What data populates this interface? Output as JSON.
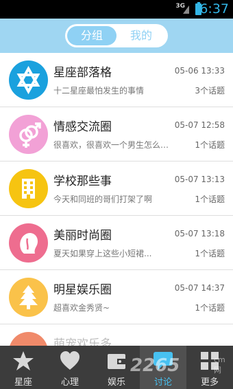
{
  "status_bar": {
    "network": "3G",
    "time": "6:37"
  },
  "header": {
    "segments": [
      {
        "label": "分组"
      },
      {
        "label": "我的"
      }
    ]
  },
  "groups": [
    {
      "icon": "star-of-david-icon",
      "color": "#1aa1de",
      "title": "星座部落格",
      "time": "05-06 13:33",
      "desc": "十二星座最怕发生的事情",
      "count": "3个话题"
    },
    {
      "icon": "gender-symbols-icon",
      "color": "#f2a1d6",
      "title": "情感交流圈",
      "time": "05-07 12:58",
      "desc": "很喜欢，很喜欢一个男生怎么办？",
      "count": "1个话题"
    },
    {
      "icon": "building-icon",
      "color": "#f6c411",
      "title": "学校那些事",
      "time": "05-07 13:13",
      "desc": "今天和同班的哥们打架了啊",
      "count": "1个话题"
    },
    {
      "icon": "woman-profile-icon",
      "color": "#ee6d8f",
      "title": "美丽时尚圈",
      "time": "05-07 13:18",
      "desc": "夏天如果穿上这些小短裙...",
      "count": "1个话题"
    },
    {
      "icon": "tree-icon",
      "color": "#fac24a",
      "title": "明星娱乐圈",
      "time": "05-07 14:37",
      "desc": "超喜欢金秀贤~",
      "count": "1个话题"
    },
    {
      "icon": "music-icon",
      "color": "#f08a6a",
      "title": "萌宠欢乐多",
      "time": "",
      "desc": "",
      "count": ""
    }
  ],
  "tabbar": [
    {
      "label": "星座",
      "icon": "star-icon"
    },
    {
      "label": "心理",
      "icon": "heart-icon"
    },
    {
      "label": "娱乐",
      "icon": "wallet-icon"
    },
    {
      "label": "讨论",
      "icon": "chat-icon",
      "active": true
    },
    {
      "label": "更多",
      "icon": "grid-icon"
    }
  ],
  "watermark": {
    "text": "2265",
    "sub": "cm网"
  }
}
